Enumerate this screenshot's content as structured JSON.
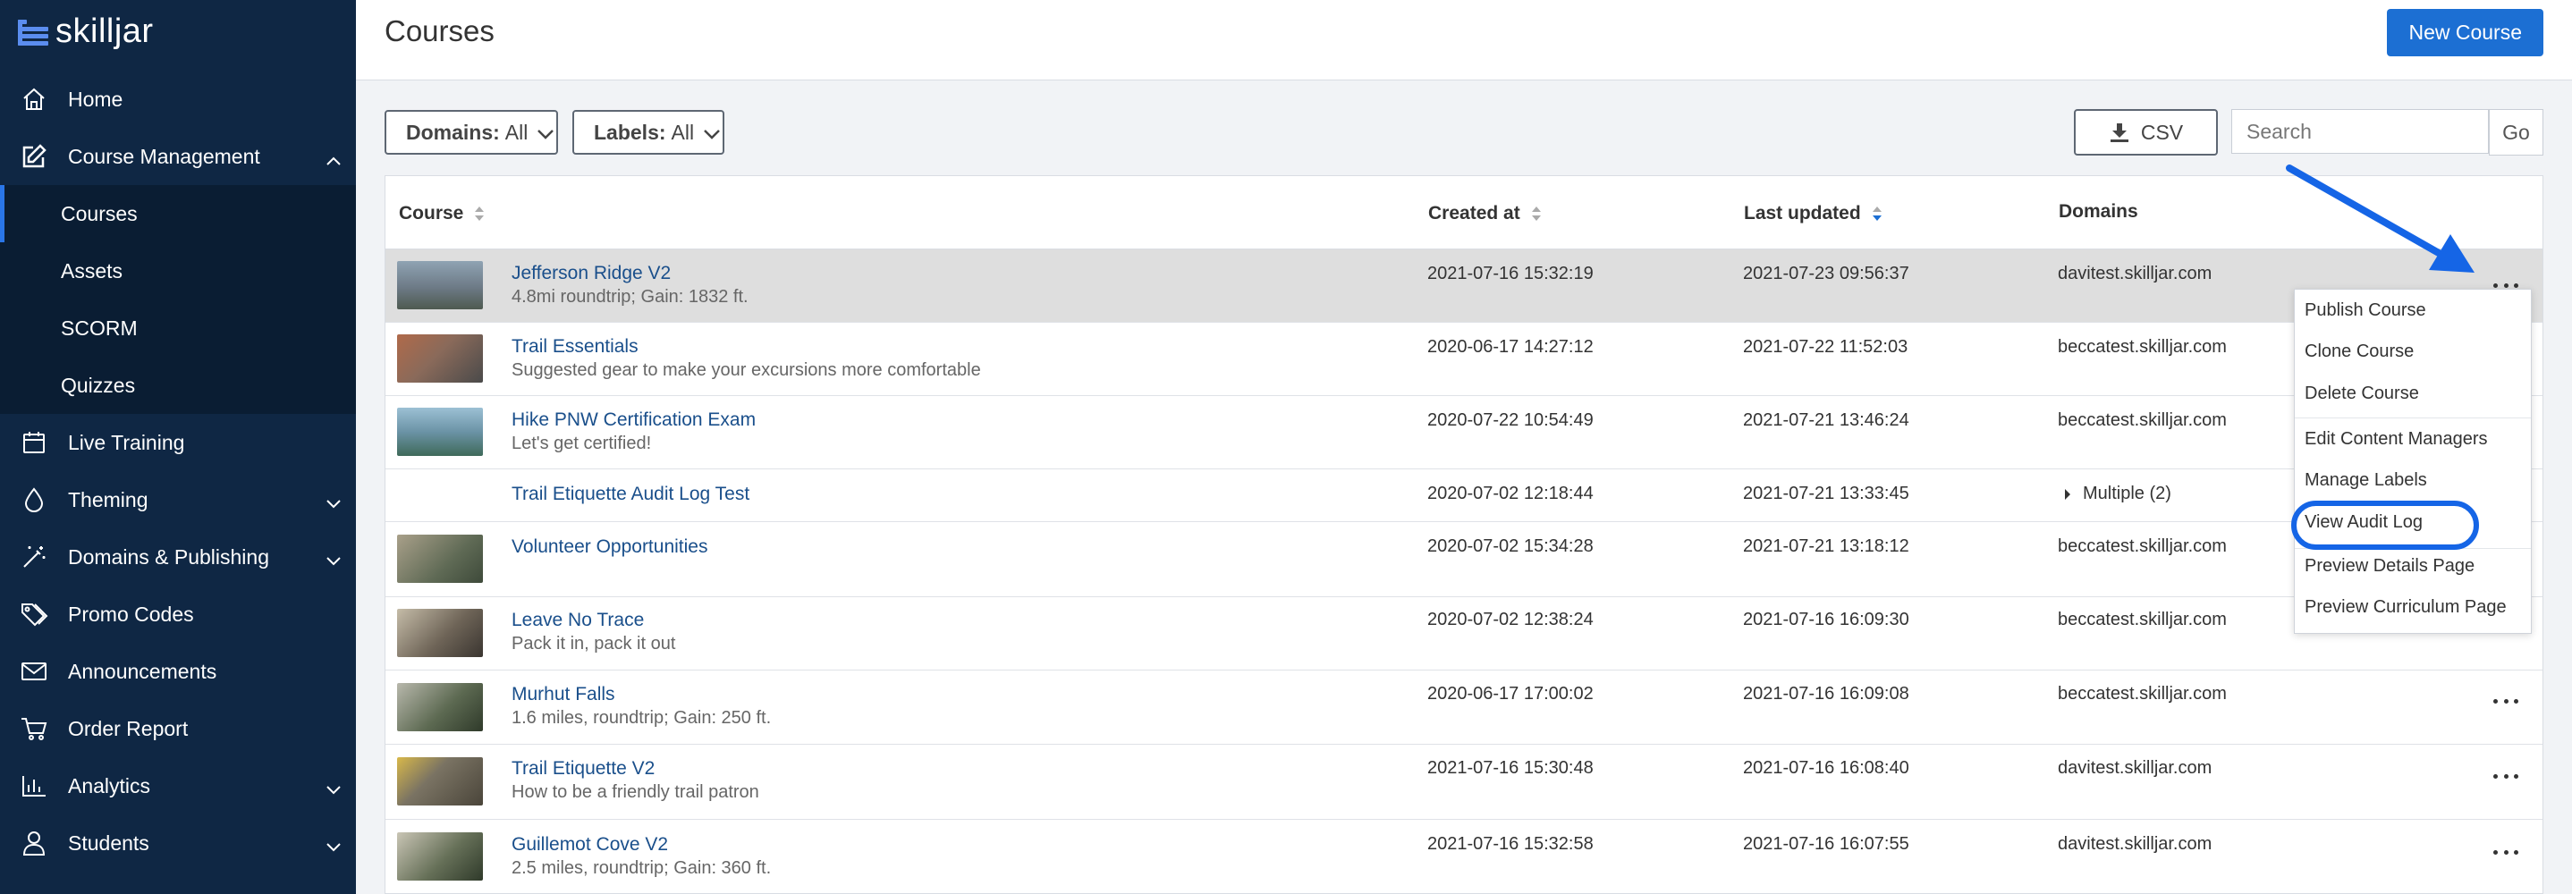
{
  "app": {
    "logo_text": "skilljar"
  },
  "sidebar": {
    "items": [
      {
        "label": "Home",
        "icon": "home-icon"
      },
      {
        "label": "Course Management",
        "icon": "edit-icon",
        "expanded": true
      },
      {
        "label": "Live Training",
        "icon": "calendar-icon"
      },
      {
        "label": "Theming",
        "icon": "droplet-icon"
      },
      {
        "label": "Domains & Publishing",
        "icon": "magic-wand-icon"
      },
      {
        "label": "Promo Codes",
        "icon": "tags-icon"
      },
      {
        "label": "Announcements",
        "icon": "envelope-icon"
      },
      {
        "label": "Order Report",
        "icon": "cart-icon"
      },
      {
        "label": "Analytics",
        "icon": "bar-chart-icon"
      },
      {
        "label": "Students",
        "icon": "user-icon"
      }
    ],
    "course_management_subitems": [
      "Courses",
      "Assets",
      "SCORM",
      "Quizzes"
    ]
  },
  "header": {
    "title": "Courses",
    "new_course_label": "New Course"
  },
  "filters": {
    "domains_label": "Domains:",
    "domains_value": "All",
    "labels_label": "Labels:",
    "labels_value": "All",
    "csv_label": "CSV",
    "search_placeholder": "Search",
    "go_label": "Go"
  },
  "table": {
    "columns": {
      "course": "Course",
      "created_at": "Created at",
      "last_updated": "Last updated",
      "domains": "Domains"
    },
    "rows": [
      {
        "title": "Jefferson Ridge V2",
        "subtitle": "4.8mi roundtrip; Gain: 1832 ft.",
        "created": "2021-07-16 15:32:19",
        "updated": "2021-07-23 09:56:37",
        "domain": "davitest.skilljar.com",
        "thumb_color": "#6d7a86"
      },
      {
        "title": "Trail Essentials",
        "subtitle": "Suggested gear to make your excursions more comfortable",
        "created": "2020-06-17 14:27:12",
        "updated": "2021-07-22 11:52:03",
        "domain": "beccatest.skilljar.com",
        "thumb_color": "#8a6a5a"
      },
      {
        "title": "Hike PNW Certification Exam",
        "subtitle": "Let's get certified!",
        "created": "2020-07-22 10:54:49",
        "updated": "2021-07-21 13:46:24",
        "domain": "beccatest.skilljar.com",
        "thumb_color": "#6b93a6"
      },
      {
        "title": "Trail Etiquette Audit Log Test",
        "subtitle": "",
        "created": "2020-07-02 12:18:44",
        "updated": "2021-07-21 13:33:45",
        "domain": "Multiple (2)",
        "thumb_color": ""
      },
      {
        "title": "Volunteer Opportunities",
        "subtitle": "",
        "created": "2020-07-02 15:34:28",
        "updated": "2021-07-21 13:18:12",
        "domain": "beccatest.skilljar.com",
        "thumb_color": "#5f6a55"
      },
      {
        "title": "Leave No Trace",
        "subtitle": "Pack it in, pack it out",
        "created": "2020-07-02 12:38:24",
        "updated": "2021-07-16 16:09:30",
        "domain": "beccatest.skilljar.com",
        "thumb_color": "#6f6558"
      },
      {
        "title": "Murhut Falls",
        "subtitle": "1.6 miles, roundtrip; Gain: 250 ft.",
        "created": "2020-06-17 17:00:02",
        "updated": "2021-07-16 16:09:08",
        "domain": "beccatest.skilljar.com",
        "thumb_color": "#5d6a52"
      },
      {
        "title": "Trail Etiquette V2",
        "subtitle": "How to be a friendly trail patron",
        "created": "2021-07-16 15:30:48",
        "updated": "2021-07-16 16:08:40",
        "domain": "davitest.skilljar.com",
        "thumb_color": "#7a7363"
      },
      {
        "title": "Guillemot Cove V2",
        "subtitle": "2.5 miles, roundtrip; Gain: 360 ft.",
        "created": "2021-07-16 15:32:58",
        "updated": "2021-07-16 16:07:55",
        "domain": "davitest.skilljar.com",
        "thumb_color": "#667058"
      }
    ]
  },
  "row_menu": {
    "items": [
      "Publish Course",
      "Clone Course",
      "Delete Course",
      "Edit Content Managers",
      "Manage Labels",
      "View Audit Log",
      "Preview Details Page",
      "Preview Curriculum Page"
    ],
    "highlighted": "View Audit Log"
  },
  "colors": {
    "sidebar_bg": "#0f2744",
    "primary": "#1c6fd3",
    "link": "#1a4f8b",
    "annotation": "#1565e6"
  }
}
